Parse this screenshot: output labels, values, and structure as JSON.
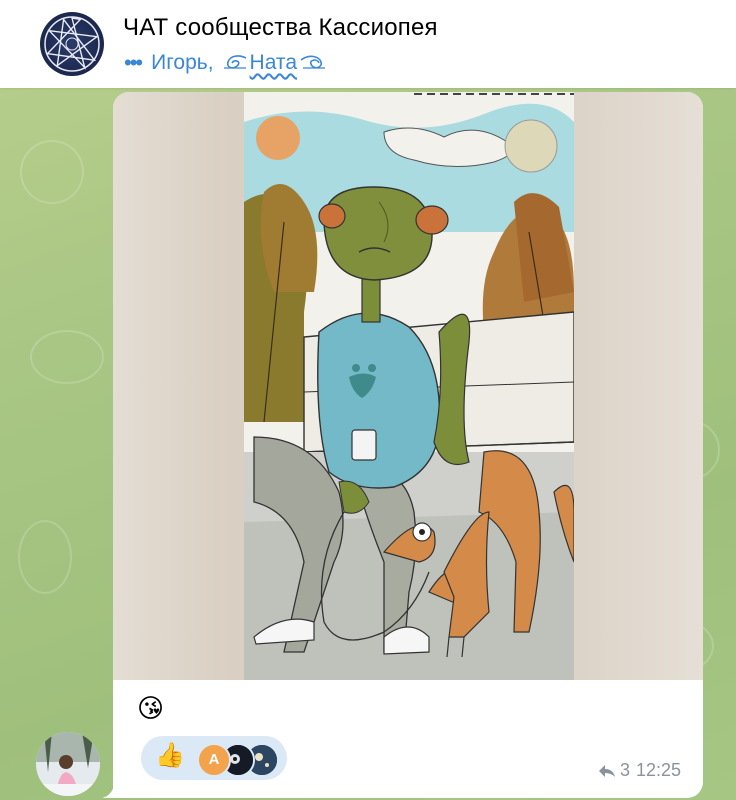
{
  "header": {
    "title": "ЧАТ сообщества Кассиопея",
    "typing_dots": "•••",
    "typing_users": "Игорь,",
    "typing_name2": "Ната",
    "avatar_icon": "heptagram-star-icon"
  },
  "message": {
    "emoji": "😘",
    "reactions": {
      "emoji": "👍",
      "avatar_letter": "A"
    },
    "reply_count": "3",
    "time": "12:25"
  },
  "colors": {
    "accent": "#3a86d8",
    "reaction_bg": "#dbe9f7",
    "meta": "#8a939c",
    "wallpaper": "#a9c684"
  }
}
